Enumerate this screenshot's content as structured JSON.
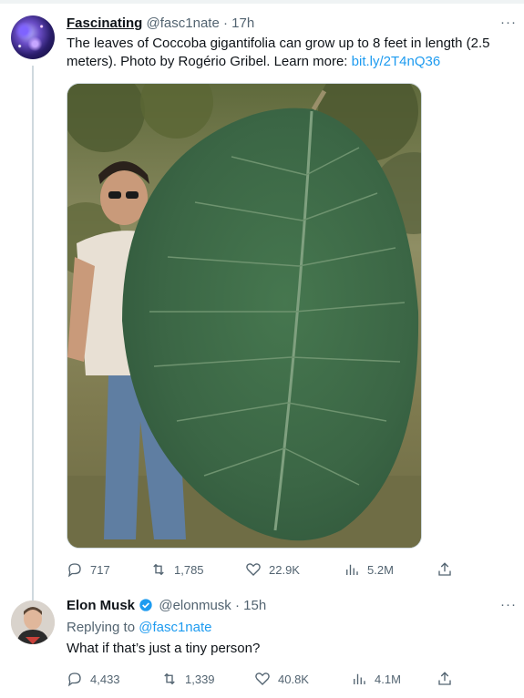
{
  "tweet1": {
    "display_name": "Fascinating",
    "handle": "@fasc1nate",
    "separator": "·",
    "time": "17h",
    "more": "···",
    "text": "The leaves of Coccoba gigantifolia can grow up to 8 feet in length (2.5 meters). Photo by Rogério Gribel. Learn more: ",
    "link": "bit.ly/2T4nQ36",
    "stats": {
      "replies": "717",
      "retweets": "1,785",
      "likes": "22.9K",
      "views": "5.2M"
    }
  },
  "tweet2": {
    "display_name": "Elon Musk",
    "handle": "@elonmusk",
    "separator": "·",
    "time": "15h",
    "more": "···",
    "replying_label": "Replying to ",
    "replying_handle": "@fasc1nate",
    "text": "What if that’s just a tiny person?",
    "stats": {
      "replies": "4,433",
      "retweets": "1,339",
      "likes": "40.8K",
      "views": "4.1M"
    }
  },
  "icons": {
    "reply": "reply-icon",
    "retweet": "retweet-icon",
    "like": "heart-icon",
    "views": "views-icon",
    "share": "share-icon",
    "verified": "verified-badge-icon"
  },
  "colors": {
    "link": "#1d9bf0",
    "muted": "#536471",
    "text": "#0f1419",
    "leaf": "#3f6a4b"
  }
}
